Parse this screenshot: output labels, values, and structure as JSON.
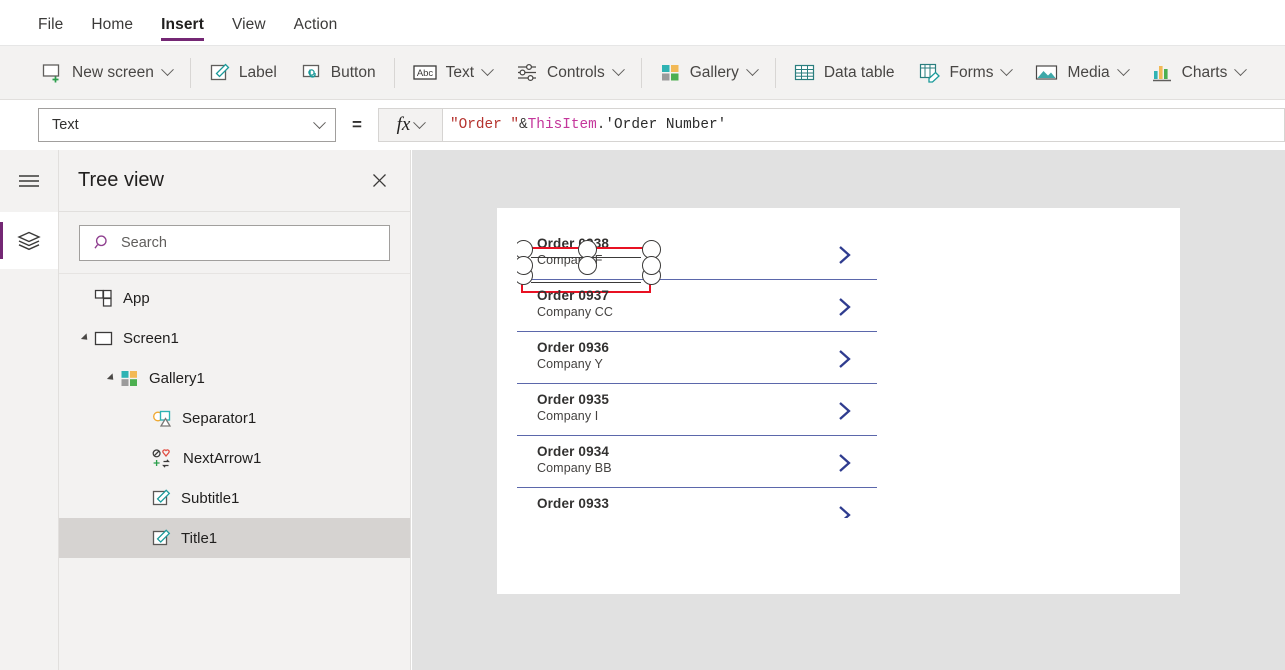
{
  "menu": {
    "items": [
      {
        "label": "File",
        "active": false
      },
      {
        "label": "Home",
        "active": false
      },
      {
        "label": "Insert",
        "active": true
      },
      {
        "label": "View",
        "active": false
      },
      {
        "label": "Action",
        "active": false
      }
    ]
  },
  "ribbon": {
    "items": [
      {
        "label": "New screen",
        "icon": "new-screen-icon",
        "caret": true
      },
      {
        "label": "Label",
        "icon": "label-icon",
        "caret": false
      },
      {
        "label": "Button",
        "icon": "button-icon",
        "caret": false
      },
      {
        "label": "Text",
        "icon": "text-abc-icon",
        "caret": true
      },
      {
        "label": "Controls",
        "icon": "controls-sliders-icon",
        "caret": true
      },
      {
        "label": "Gallery",
        "icon": "gallery-icon",
        "caret": true
      },
      {
        "label": "Data table",
        "icon": "data-table-icon",
        "caret": false
      },
      {
        "label": "Forms",
        "icon": "forms-icon",
        "caret": true
      },
      {
        "label": "Media",
        "icon": "media-image-icon",
        "caret": true
      },
      {
        "label": "Charts",
        "icon": "charts-bar-icon",
        "caret": true
      }
    ]
  },
  "formula_bar": {
    "property": "Text",
    "equals": "=",
    "fx_label": "fx",
    "formula_tokens": [
      {
        "text": "\"Order \"",
        "kind": "string"
      },
      {
        "text": " & ",
        "kind": "operator"
      },
      {
        "text": "ThisItem",
        "kind": "identifier"
      },
      {
        "text": ".",
        "kind": "dot"
      },
      {
        "text": "'Order Number'",
        "kind": "column"
      }
    ],
    "formula_plain": "\"Order \" & ThisItem.'Order Number'"
  },
  "tree_panel": {
    "title": "Tree view",
    "close_label": "✕",
    "search_placeholder": "Search",
    "nodes": [
      {
        "label": "App",
        "indent": 0,
        "icon": "app-icon",
        "twisty": "none",
        "selected": false
      },
      {
        "label": "Screen1",
        "indent": 0,
        "icon": "screen-icon",
        "twisty": "expanded",
        "selected": false
      },
      {
        "label": "Gallery1",
        "indent": 1,
        "icon": "gallery-icon",
        "twisty": "expanded",
        "selected": false
      },
      {
        "label": "Separator1",
        "indent": 2,
        "icon": "shapes-icon",
        "twisty": "none",
        "selected": false
      },
      {
        "label": "NextArrow1",
        "indent": 2,
        "icon": "icons-grid-icon",
        "twisty": "none",
        "selected": false
      },
      {
        "label": "Subtitle1",
        "indent": 2,
        "icon": "label-icon",
        "twisty": "none",
        "selected": false
      },
      {
        "label": "Title1",
        "indent": 2,
        "icon": "label-icon",
        "twisty": "none",
        "selected": true
      }
    ]
  },
  "canvas": {
    "gallery": {
      "rows": [
        {
          "title": "Order 0938",
          "subtitle": "Company F",
          "selected": true,
          "clipped": false
        },
        {
          "title": "Order 0937",
          "subtitle": "Company CC",
          "selected": false,
          "clipped": false
        },
        {
          "title": "Order 0936",
          "subtitle": "Company Y",
          "selected": false,
          "clipped": false
        },
        {
          "title": "Order 0935",
          "subtitle": "Company I",
          "selected": false,
          "clipped": false
        },
        {
          "title": "Order 0934",
          "subtitle": "Company BB",
          "selected": false,
          "clipped": false
        },
        {
          "title": "Order 0933",
          "subtitle": "",
          "selected": false,
          "clipped": true
        }
      ]
    }
  },
  "colors": {
    "accent_purple": "#742774",
    "selection_red": "#e81123",
    "chevron_navy": "#2f3c8f",
    "separator_navy": "#5b67ab",
    "ribbon_bg": "#f3f2f1",
    "canvas_bg": "#e1e1e1",
    "string_token": "#b5332e",
    "identifier_token": "#c4369b"
  }
}
